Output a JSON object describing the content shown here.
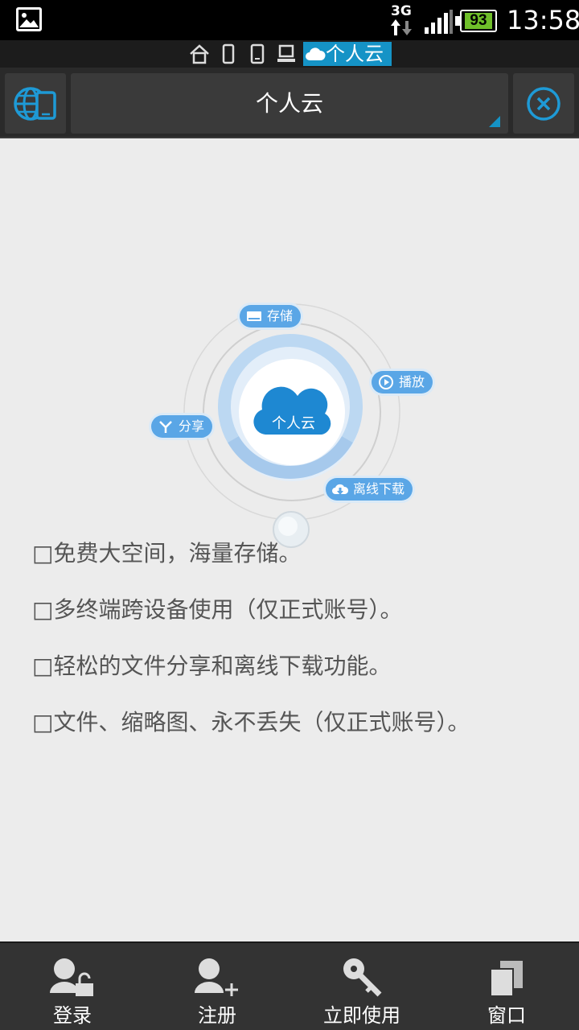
{
  "status_bar": {
    "network": "3G",
    "battery": "93",
    "time": "13:58"
  },
  "nav_strip": {
    "active_tab": "个人云"
  },
  "toolbar": {
    "title": "个人云"
  },
  "illustration": {
    "center_label": "个人云",
    "pills": {
      "storage": "存储",
      "play": "播放",
      "share": "分享",
      "offline_download": "离线下载"
    }
  },
  "features": [
    "□免费大空间，海量存储。",
    "□多终端跨设备使用（仅正式账号）。",
    "□轻松的文件分享和离线下载功能。",
    "□文件、缩略图、永不丢失（仅正式账号）。"
  ],
  "bottom_bar": {
    "login": "登录",
    "register": "注册",
    "use_now": "立即使用",
    "window": "窗口"
  },
  "colors": {
    "accent": "#1593c6",
    "cloud_blue": "#1e88d2",
    "pill_blue": "#5aa6e6"
  }
}
